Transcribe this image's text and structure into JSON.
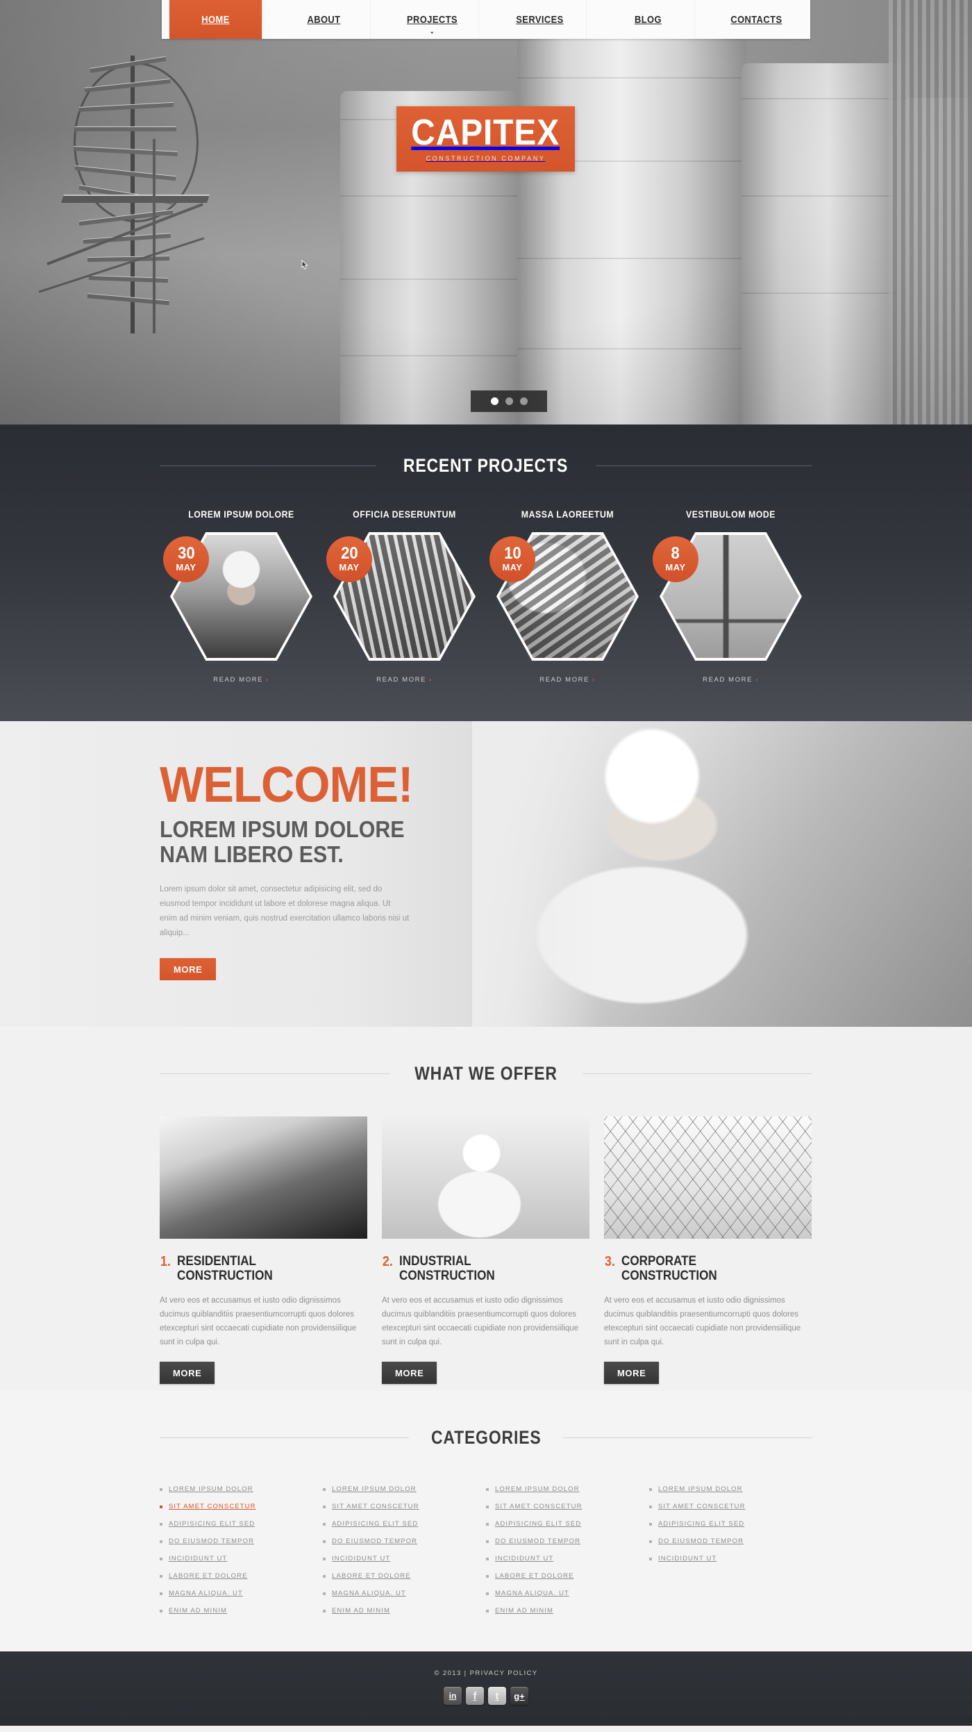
{
  "nav": {
    "items": [
      {
        "label": "HOME",
        "active": true,
        "caret": ""
      },
      {
        "label": "ABOUT",
        "active": false,
        "caret": ""
      },
      {
        "label": "PROJECTS",
        "active": false,
        "caret": "⌄"
      },
      {
        "label": "SERVICES",
        "active": false,
        "caret": ""
      },
      {
        "label": "BLOG",
        "active": false,
        "caret": ""
      },
      {
        "label": "CONTACTS",
        "active": false,
        "caret": ""
      }
    ]
  },
  "logo": {
    "title": "CAPITEX",
    "subtitle": "CONSTRUCTION COMPANY"
  },
  "slider": {
    "dots": 3,
    "active_index": 0
  },
  "projects": {
    "title": "RECENT PROJECTS",
    "items": [
      {
        "name": "LOREM IPSUM DOLORE",
        "day": "30",
        "month": "MAY",
        "read_more": "READ MORE",
        "chevron": "›"
      },
      {
        "name": "OFFICIA DESERUNTUM",
        "day": "20",
        "month": "MAY",
        "read_more": "READ MORE",
        "chevron": "›"
      },
      {
        "name": "MASSA LAOREETUM",
        "day": "10",
        "month": "MAY",
        "read_more": "READ MORE",
        "chevron": "›"
      },
      {
        "name": "VESTIBULOM MODE",
        "day": "8",
        "month": "MAY",
        "read_more": "READ MORE",
        "chevron": "›"
      }
    ]
  },
  "welcome": {
    "heading": "WELCOME!",
    "subheading": "LOREM IPSUM DOLORE\nNAM LIBERO EST.",
    "paragraph": "Lorem ipsum dolor sit amet, consectetur adipisicing elit, sed do eiusmod tempor incididunt ut labore et dolorese magna aliqua. Ut enim ad minim veniam, quis nostrud exercitation ullamco laboris nisi ut aliquip...",
    "button": "MORE"
  },
  "offer": {
    "title": "WHAT WE OFFER",
    "cards": [
      {
        "num": "1.",
        "heading": "RESIDENTIAL\nCONSTRUCTION",
        "text": "At vero eos et accusamus et iusto odio dignissimos ducimus quiblanditiis praesentiumcorrupti quos dolores etexcepturi sint occaecati cupidiate non providensiilique sunt in culpa qui.",
        "button": "MORE"
      },
      {
        "num": "2.",
        "heading": "INDUSTRIAL\nCONSTRUCTION",
        "text": "At vero eos et accusamus et iusto odio dignissimos ducimus quiblanditiis praesentiumcorrupti quos dolores etexcepturi sint occaecati cupidiate non providensiilique sunt in culpa qui.",
        "button": "MORE"
      },
      {
        "num": "3.",
        "heading": "CORPORATE\nCONSTRUCTION",
        "text": "At vero eos et accusamus et iusto odio dignissimos ducimus quiblanditiis praesentiumcorrupti quos dolores etexcepturi sint occaecati cupidiate non providensiilique sunt in culpa qui.",
        "button": "MORE"
      }
    ]
  },
  "categories": {
    "title": "CATEGORIES",
    "columns": [
      {
        "items": [
          {
            "label": "LOREM IPSUM  DOLOR",
            "highlight": false
          },
          {
            "label": "SIT AMET CONSCETUR",
            "highlight": true
          },
          {
            "label": "ADIPISICING ELIT SED",
            "highlight": false
          },
          {
            "label": "DO EIUSMOD TEMPOR",
            "highlight": false
          },
          {
            "label": "INCIDIDUNT UT",
            "highlight": false
          },
          {
            "label": "LABORE ET DOLORE",
            "highlight": false
          },
          {
            "label": "MAGNA ALIQUA. UT",
            "highlight": false
          },
          {
            "label": "ENIM AD MINIM",
            "highlight": false
          }
        ]
      },
      {
        "items": [
          {
            "label": "LOREM IPSUM  DOLOR",
            "highlight": false
          },
          {
            "label": "SIT AMET CONSCETUR",
            "highlight": false
          },
          {
            "label": "ADIPISICING ELIT SED",
            "highlight": false
          },
          {
            "label": "DO EIUSMOD TEMPOR",
            "highlight": false
          },
          {
            "label": "INCIDIDUNT UT",
            "highlight": false
          },
          {
            "label": "LABORE ET DOLORE",
            "highlight": false
          },
          {
            "label": "MAGNA ALIQUA. UT",
            "highlight": false
          },
          {
            "label": "ENIM AD MINIM",
            "highlight": false
          }
        ]
      },
      {
        "items": [
          {
            "label": "LOREM IPSUM  DOLOR",
            "highlight": false
          },
          {
            "label": "SIT AMET CONSCETUR",
            "highlight": false
          },
          {
            "label": "ADIPISICING ELIT SED",
            "highlight": false
          },
          {
            "label": "DO EIUSMOD TEMPOR",
            "highlight": false
          },
          {
            "label": "INCIDIDUNT UT",
            "highlight": false
          },
          {
            "label": "LABORE ET DOLORE",
            "highlight": false
          },
          {
            "label": "MAGNA ALIQUA. UT",
            "highlight": false
          },
          {
            "label": "ENIM AD MINIM",
            "highlight": false
          }
        ]
      },
      {
        "items": [
          {
            "label": "LOREM IPSUM  DOLOR",
            "highlight": false
          },
          {
            "label": "SIT AMET CONSCETUR",
            "highlight": false
          },
          {
            "label": "ADIPISICING ELIT SED",
            "highlight": false
          },
          {
            "label": "DO EIUSMOD TEMPOR",
            "highlight": false
          },
          {
            "label": "INCIDIDUNT UT",
            "highlight": false
          }
        ]
      }
    ]
  },
  "footer": {
    "copyright": "© 2013 | PRIVACY POLICY",
    "socials": [
      {
        "name": "linkedin-icon",
        "glyph": "in",
        "cls": "in"
      },
      {
        "name": "facebook-icon",
        "glyph": "f",
        "cls": "fb"
      },
      {
        "name": "twitter-icon",
        "glyph": "t",
        "cls": "tw"
      },
      {
        "name": "googleplus-icon",
        "glyph": "g+",
        "cls": "gp"
      }
    ]
  },
  "colors": {
    "accent": "#d4552b",
    "accent_light": "#de6135",
    "dark": "#2a2d33",
    "body_bg": "#f1f1f1"
  }
}
